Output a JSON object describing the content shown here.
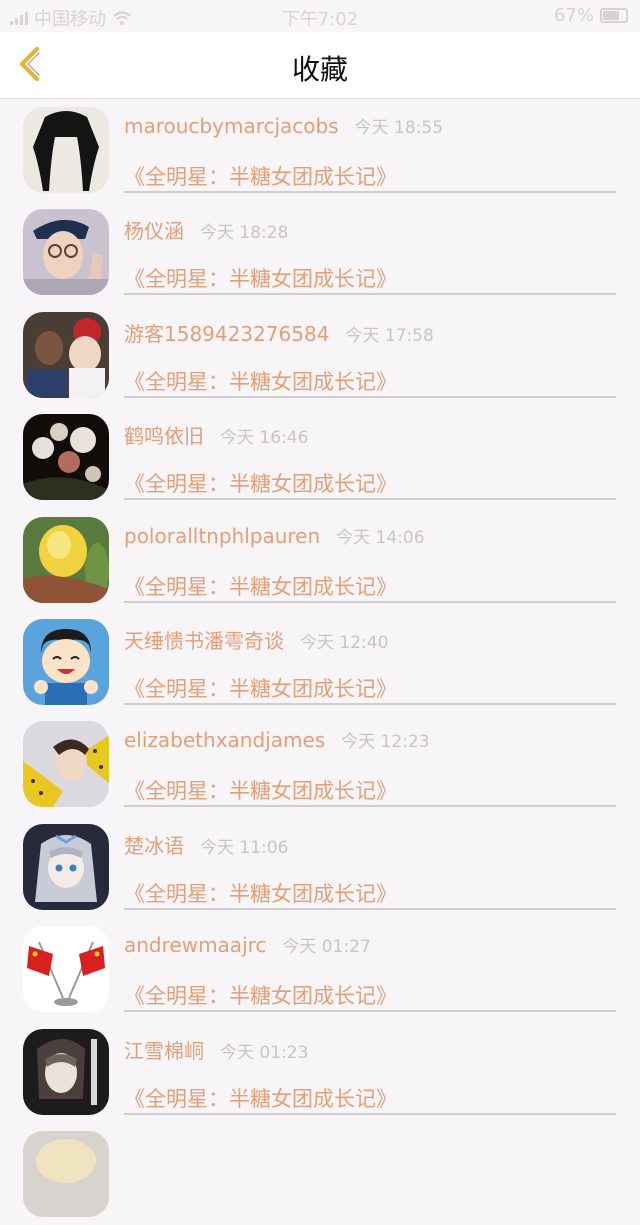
{
  "status_bar": {
    "carrier": "中国移动",
    "time": "下午7:02",
    "battery": "67%",
    "battery_level": 0.67,
    "signal_icon": "signal-bars-icon",
    "wifi_icon": "wifi-icon",
    "battery_icon": "battery-icon"
  },
  "nav": {
    "title": "收藏",
    "back_icon": "chevron-left-icon",
    "back_color": "#e2b637"
  },
  "colors": {
    "name": "#e49f77",
    "timestamp": "#c8c4c8",
    "background": "#f7f5f7"
  },
  "items": [
    {
      "user": "maroucbymarcjacobs",
      "time": "今天 18:55",
      "work": "《全明星：半糖女团成长记》"
    },
    {
      "user": "杨仪涵",
      "time": "今天 18:28",
      "work": "《全明星：半糖女团成长记》"
    },
    {
      "user": "游客1589423276584",
      "time": "今天 17:58",
      "work": "《全明星：半糖女团成长记》"
    },
    {
      "user": "鹤鸣依旧",
      "time": "今天 16:46",
      "work": "《全明星：半糖女团成长记》"
    },
    {
      "user": "poloralltnphlpauren",
      "time": "今天 14:06",
      "work": "《全明星：半糖女团成长记》"
    },
    {
      "user": "天缍愦书潘雩奇谈",
      "time": "今天 12:40",
      "work": "《全明星：半糖女团成长记》"
    },
    {
      "user": "elizabethxandjames",
      "time": "今天 12:23",
      "work": "《全明星：半糖女团成长记》"
    },
    {
      "user": "楚冰语",
      "time": "今天 11:06",
      "work": "《全明星：半糖女团成长记》"
    },
    {
      "user": "andrewmaajrc",
      "time": "今天 01:27",
      "work": "《全明星：半糖女团成长记》"
    },
    {
      "user": "江雪棉峒",
      "time": "今天 01:23",
      "work": "《全明星：半糖女团成长记》"
    }
  ]
}
